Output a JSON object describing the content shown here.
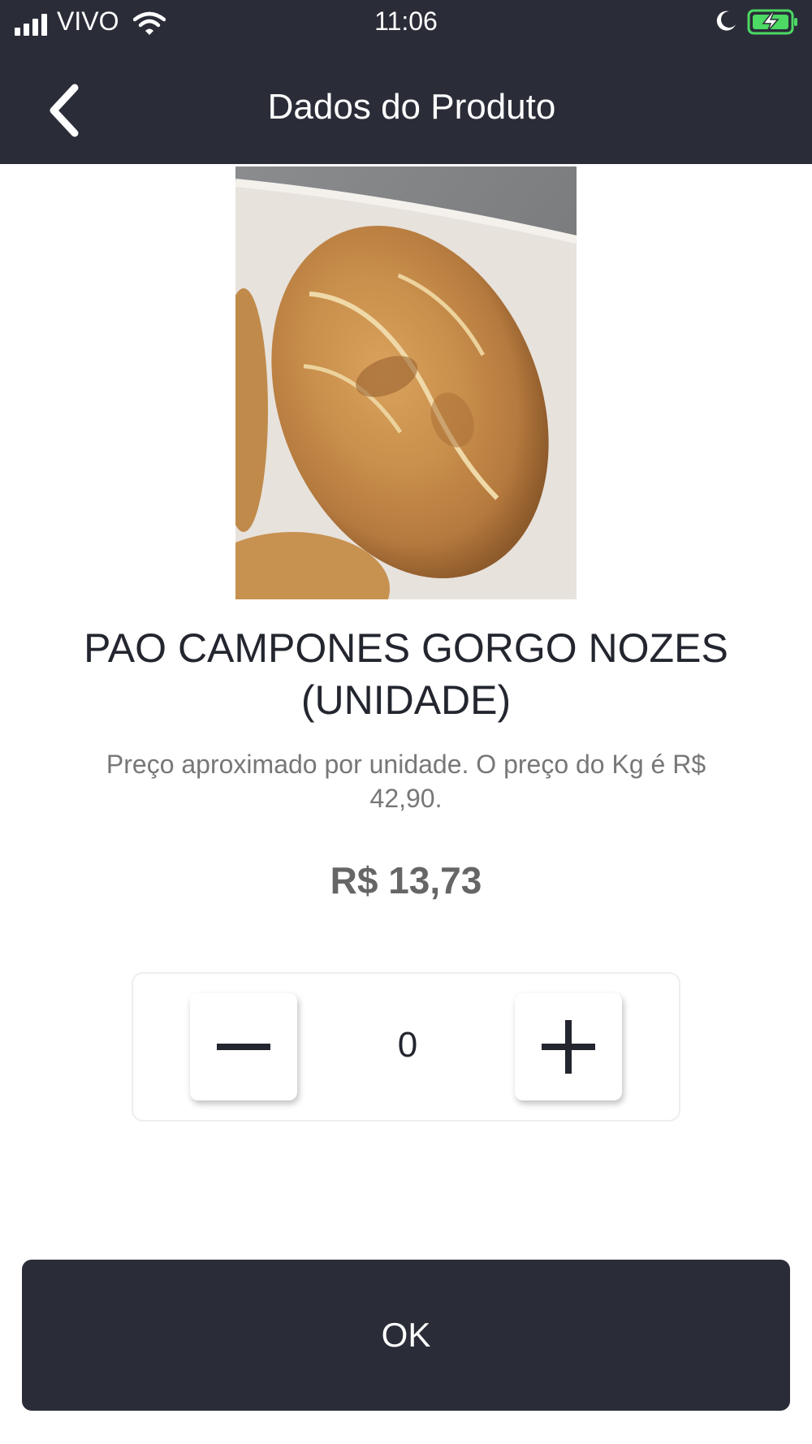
{
  "status_bar": {
    "carrier": "VIVO",
    "time": "11:06"
  },
  "nav": {
    "title": "Dados do Produto",
    "back_icon": "chevron-left-icon"
  },
  "product": {
    "image_alt": "bread-photo",
    "name": "PAO CAMPONES GORGO NOZES (UNIDADE)",
    "description": "Preço aproximado por unidade. O preço do Kg é R$ 42,90.",
    "price": "R$ 13,73"
  },
  "quantity": {
    "value": "0",
    "minus_icon": "minus-icon",
    "plus_icon": "plus-icon"
  },
  "actions": {
    "ok_label": "OK"
  },
  "colors": {
    "header_bg": "#2a2d38",
    "battery_charge": "#4cd964",
    "text_dark": "#23262f",
    "text_muted": "#777777"
  }
}
